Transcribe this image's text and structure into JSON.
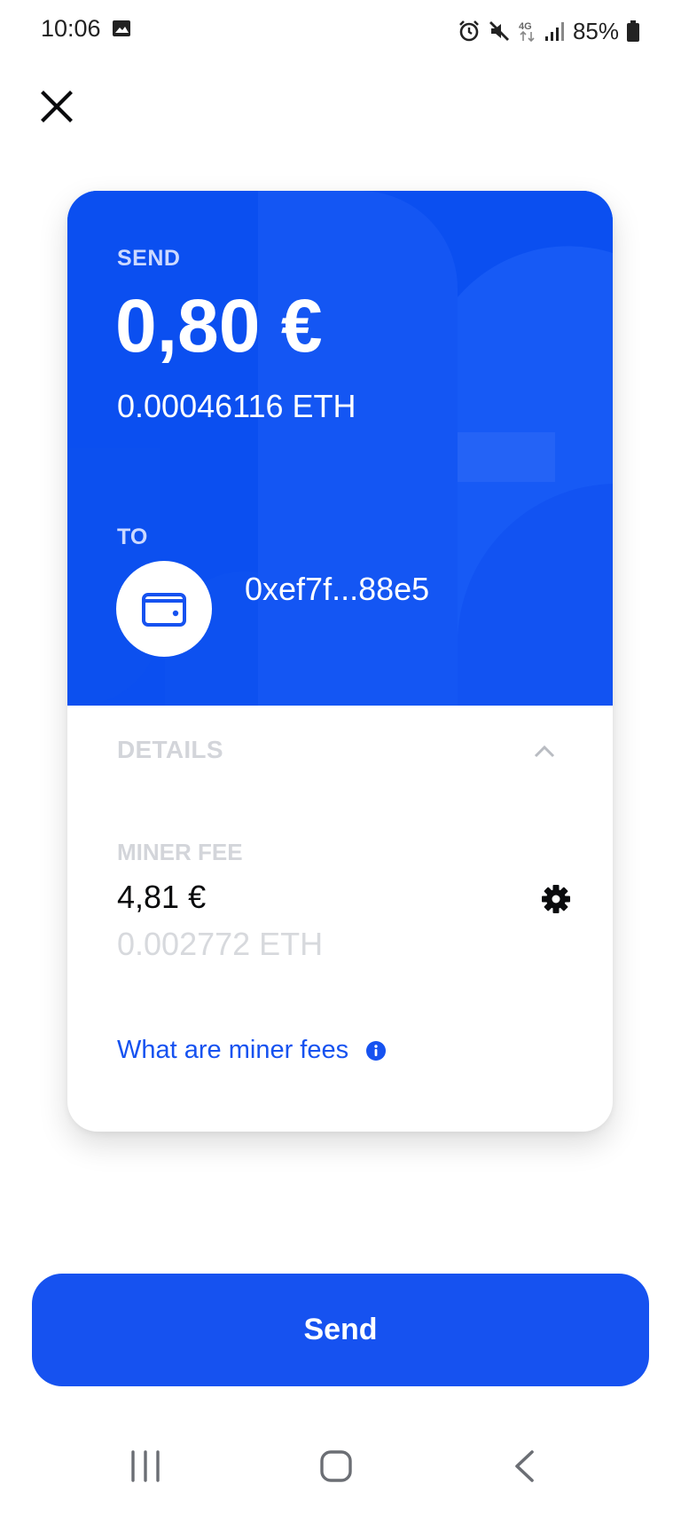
{
  "status_bar": {
    "time": "10:06",
    "battery": "85%",
    "icons": [
      "image-icon",
      "alarm-icon",
      "mute-icon",
      "4g-icon",
      "signal-icon",
      "battery-icon"
    ]
  },
  "header": {
    "close_icon": "close-icon"
  },
  "send_card": {
    "send_label": "SEND",
    "fiat_amount": "0,80 €",
    "crypto_amount": "0.00046116 ETH",
    "to_label": "TO",
    "to_address": "0xef7f...88e5",
    "wallet_icon": "wallet-icon",
    "accent_color": "#0b4ff0"
  },
  "details": {
    "label": "DETAILS",
    "toggle_icon": "chevron-up-icon",
    "miner_fee_label": "MINER FEE",
    "fee_fiat": "4,81 €",
    "fee_crypto": "0.002772 ETH",
    "settings_icon": "gear-icon",
    "link_text": "What are miner fees",
    "link_icon": "info-icon",
    "link_color": "#1652f0"
  },
  "send_button": {
    "label": "Send",
    "color": "#1652f0"
  },
  "nav_bar": {
    "icons": [
      "recents-icon",
      "home-icon",
      "back-icon"
    ]
  }
}
